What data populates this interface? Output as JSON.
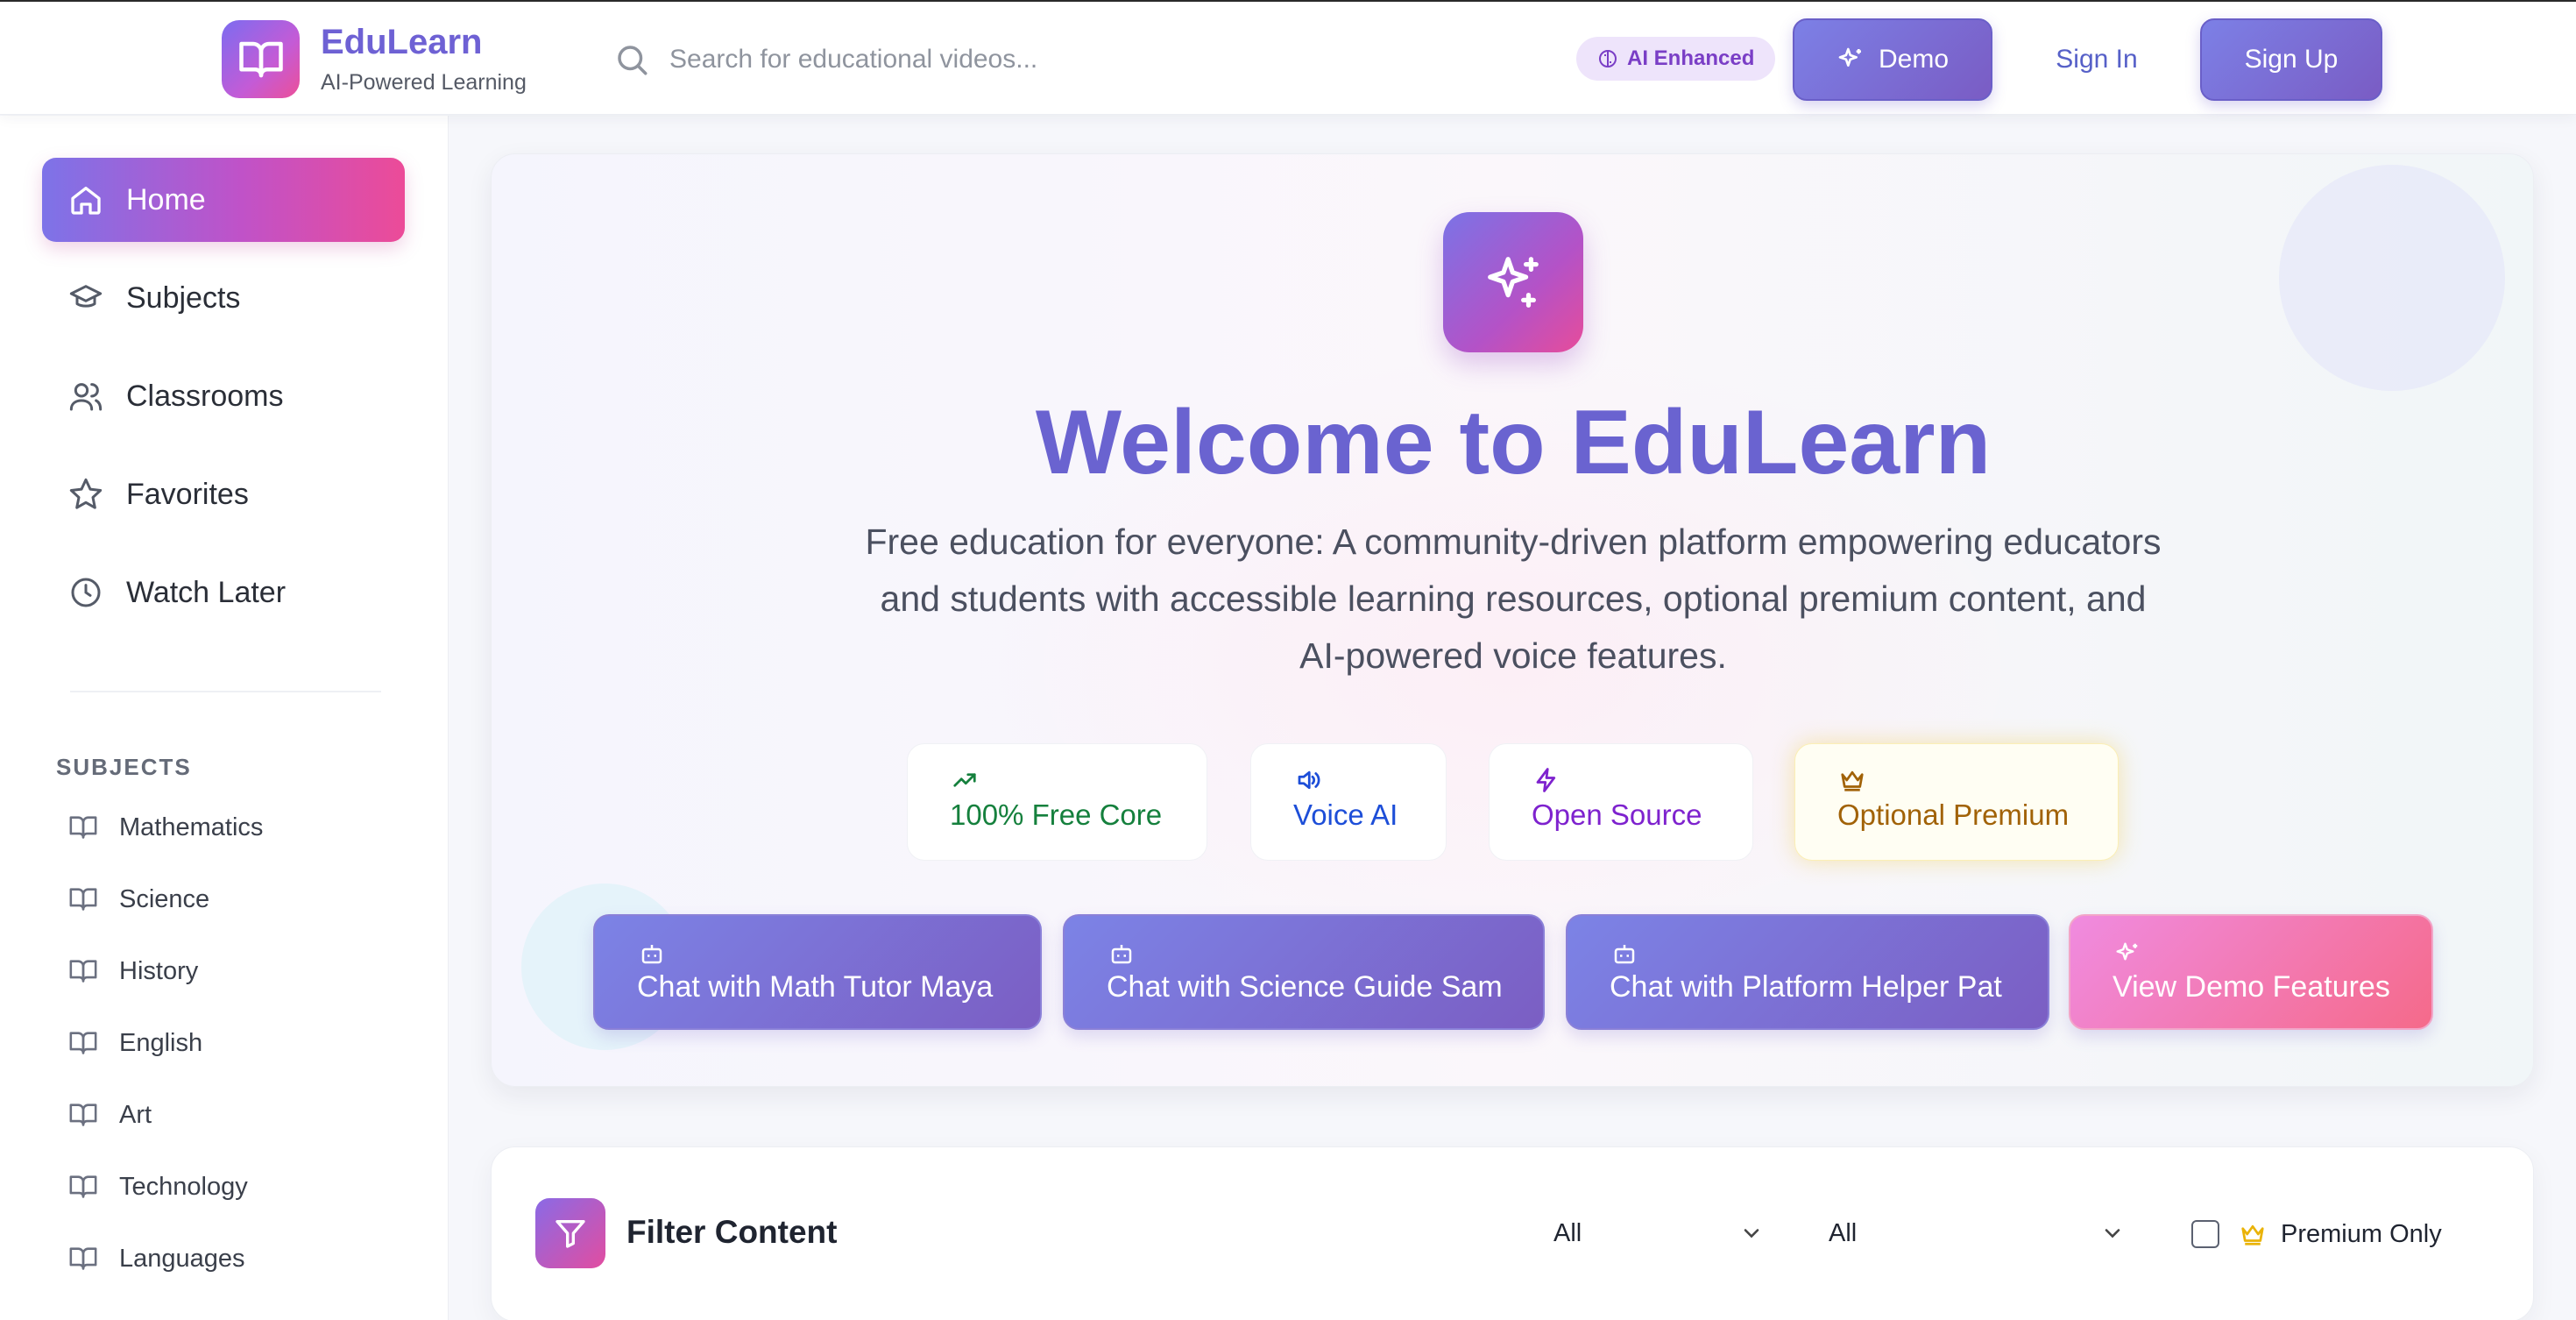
{
  "header": {
    "brand_name": "EduLearn",
    "brand_sub": "AI-Powered Learning",
    "search_placeholder": "Search for educational videos...",
    "ai_badge": "AI Enhanced",
    "demo_label": "Demo",
    "signin_label": "Sign In",
    "signup_label": "Sign Up"
  },
  "sidebar": {
    "nav": [
      {
        "label": "Home",
        "icon": "home-icon",
        "active": true
      },
      {
        "label": "Subjects",
        "icon": "graduation-cap-icon"
      },
      {
        "label": "Classrooms",
        "icon": "users-icon"
      },
      {
        "label": "Favorites",
        "icon": "star-icon"
      },
      {
        "label": "Watch Later",
        "icon": "clock-icon"
      }
    ],
    "subjects_title": "SUBJECTS",
    "subjects": [
      "Mathematics",
      "Science",
      "History",
      "English",
      "Art",
      "Technology",
      "Languages"
    ]
  },
  "hero": {
    "title": "Welcome to EduLearn",
    "description": "Free education for everyone: A community-driven platform empowering educators and students with accessible learning resources, optional premium content, and AI-powered voice features.",
    "features": [
      {
        "label": "100% Free Core",
        "icon": "trending-up-icon",
        "color": "#15803d"
      },
      {
        "label": "Voice AI",
        "icon": "volume-icon",
        "color": "#1d4ed8"
      },
      {
        "label": "Open Source",
        "icon": "zap-icon",
        "color": "#7e22ce"
      },
      {
        "label": "Optional Premium",
        "icon": "crown-icon",
        "color": "#a16207"
      }
    ],
    "chat_buttons": [
      {
        "label": "Chat with Math Tutor Maya",
        "icon": "bot-icon"
      },
      {
        "label": "Chat with Science Guide Sam",
        "icon": "bot-icon"
      },
      {
        "label": "Chat with Platform Helper Pat",
        "icon": "bot-icon"
      },
      {
        "label": "View Demo Features",
        "icon": "sparkles-icon"
      }
    ]
  },
  "filter": {
    "title": "Filter Content",
    "select_1_value": "All",
    "select_2_value": "All",
    "premium_only_label": "Premium Only",
    "premium_only_checked": false
  },
  "colors": {
    "brand": "#6e61d4",
    "accent_pink": "#ec4f98",
    "premium_gold": "#eab308"
  }
}
